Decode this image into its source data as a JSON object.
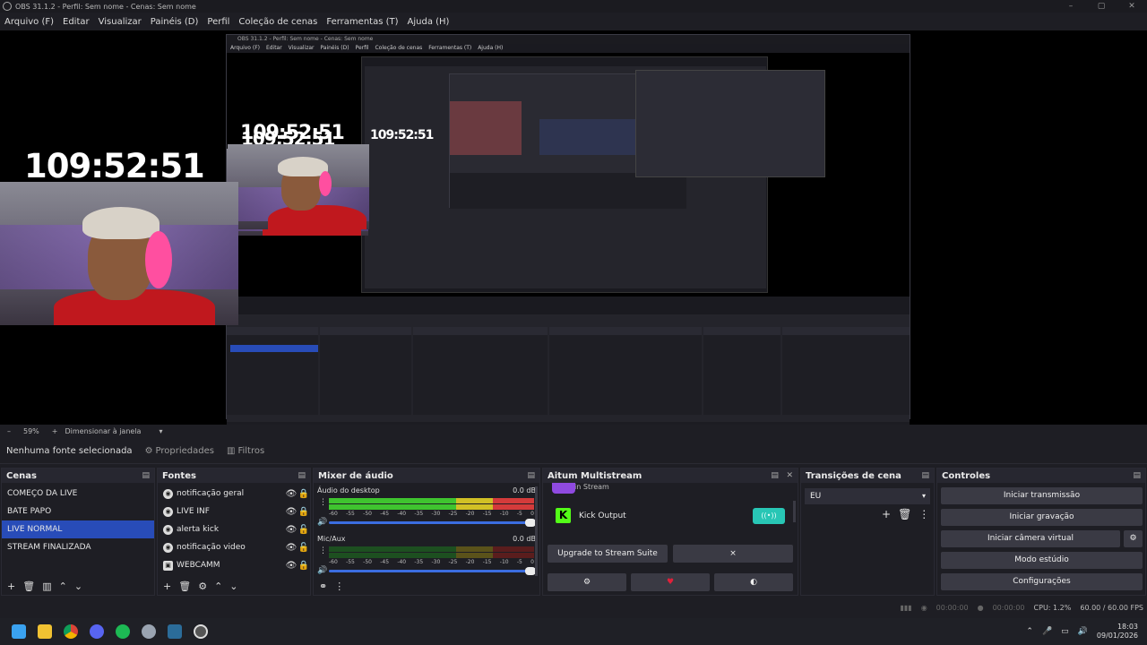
{
  "window": {
    "title": "OBS 31.1.2 - Perfil: Sem nome - Cenas: Sem nome"
  },
  "menu": [
    "Arquivo (F)",
    "Editar",
    "Visualizar",
    "Painéis (D)",
    "Perfil",
    "Coleção de cenas",
    "Ferramentas (T)",
    "Ajuda (H)"
  ],
  "preview": {
    "timer": "109:52:51",
    "inner_title": "OBS 31.1.2 - Perfil: Sem nome - Cenas: Sem nome",
    "inner_menu": [
      "Arquivo (F)",
      "Editar",
      "Visualizar",
      "Painéis (D)",
      "Perfil",
      "Coleção de cenas",
      "Ferramentas (T)",
      "Ajuda (H)"
    ]
  },
  "zoom": {
    "minus": "–",
    "value": "59%",
    "plus": "+",
    "fit_label": "Dimensionar à janela"
  },
  "source_bar": {
    "no_source": "Nenhuma fonte selecionada",
    "properties": "Propriedades",
    "filters": "Filtros"
  },
  "scenes": {
    "title": "Cenas",
    "items": [
      "COMEÇO DA LIVE",
      "BATE PAPO",
      "LIVE NORMAL",
      "STREAM FINALIZADA"
    ],
    "selected_index": 2
  },
  "sources": {
    "title": "Fontes",
    "items": [
      {
        "name": "notificação geral",
        "locked": true
      },
      {
        "name": "LIVE INF",
        "locked": true
      },
      {
        "name": "alerta kick",
        "locked": false
      },
      {
        "name": "notificação video",
        "locked": false
      },
      {
        "name": "WEBCAMM",
        "locked": true
      }
    ]
  },
  "mixer": {
    "title": "Mixer de áudio",
    "channels": [
      {
        "name": "Áudio do desktop",
        "db": "0.0 dB",
        "active": true
      },
      {
        "name": "Mic/Aux",
        "db": "0.0 dB",
        "active": false
      }
    ],
    "ticks": [
      "-60",
      "-55",
      "-50",
      "-45",
      "-40",
      "-35",
      "-30",
      "-25",
      "-20",
      "-15",
      "-10",
      "-5",
      "0"
    ]
  },
  "multistream": {
    "title": "Aitum Multistream",
    "built_in": "Built-in Stream",
    "kick_output": "Kick Output",
    "upgrade": "Upgrade to Stream Suite",
    "close_x": "×"
  },
  "transitions": {
    "title": "Transições de cena",
    "selected": "EU"
  },
  "controls": {
    "title": "Controles",
    "buttons": [
      "Iniciar transmissão",
      "Iniciar gravação",
      "Iniciar câmera virtual",
      "Modo estúdio",
      "Configurações"
    ]
  },
  "status": {
    "stream_time": "00:00:00",
    "rec_time": "00:00:00",
    "cpu": "CPU: 1.2%",
    "fps": "60.00 / 60.00 FPS"
  },
  "taskbar": {
    "time": "18:03",
    "date": "09/01/2026"
  },
  "colors": {
    "accent": "#284cb8",
    "kick": "#53fc18",
    "teal": "#28c6b5"
  }
}
